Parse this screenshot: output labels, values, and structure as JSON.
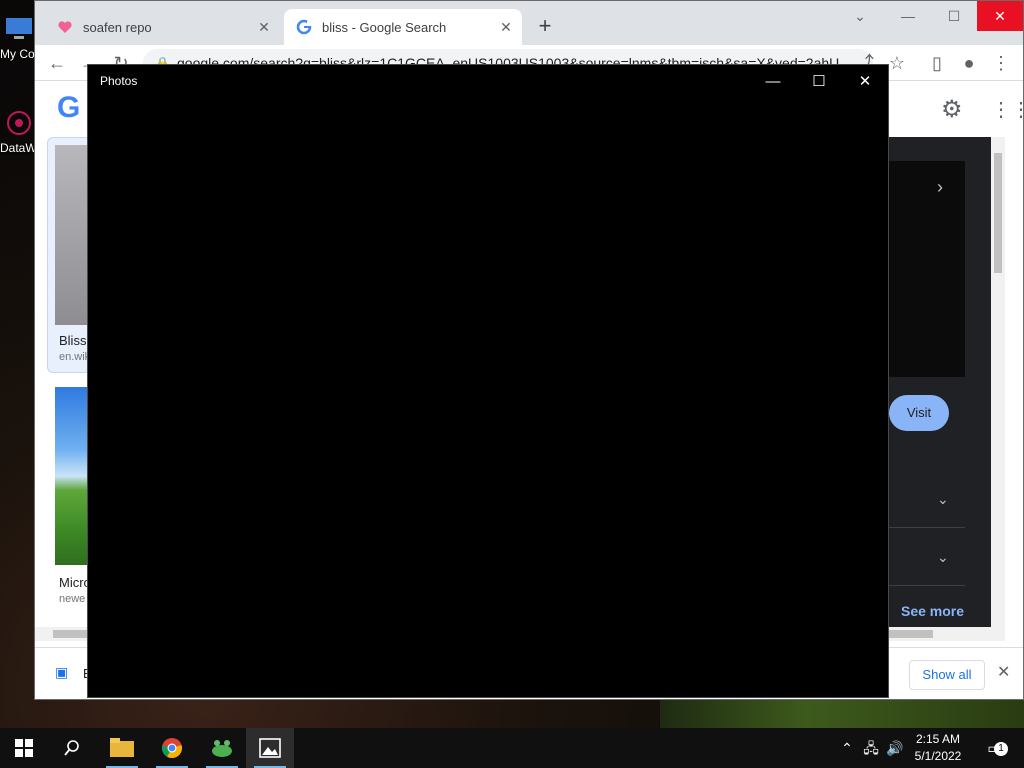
{
  "desktop": {
    "icons": [
      {
        "label": "My Co",
        "icon": "computer-icon"
      },
      {
        "label": "DataW",
        "icon": "datawrapper-icon"
      }
    ]
  },
  "browser": {
    "tabs": [
      {
        "title": "soafen repo",
        "icon": "heart-favicon",
        "active": false
      },
      {
        "title": "bliss - Google Search",
        "icon": "google-favicon",
        "active": true
      }
    ],
    "new_tab": "+",
    "window_controls": {
      "dropdown": "⌄",
      "minimize": "—",
      "maximize": "☐",
      "close": "✕"
    },
    "url": "google.com/search?q=bliss&rlz=1C1GCEA_enUS1003US1003&source=lnms&tbm=isch&sa=X&ved=2ahU",
    "page": {
      "logo": "G",
      "results": [
        {
          "title": "Bliss",
          "source": "en.wiki"
        },
        {
          "title": "Micro",
          "source": "newe"
        }
      ],
      "panel": {
        "visit_label": "Visit",
        "see_more": "See more"
      }
    },
    "download_bar": {
      "file_label": "B",
      "show_all": "Show all"
    }
  },
  "photos": {
    "title": "Photos",
    "controls": {
      "minimize": "—",
      "maximize": "☐",
      "close": "✕"
    }
  },
  "taskbar": {
    "apps": [
      {
        "name": "file-explorer",
        "running": true,
        "active": false
      },
      {
        "name": "chrome",
        "running": true,
        "active": false
      },
      {
        "name": "app-green",
        "running": true,
        "active": false
      },
      {
        "name": "photos",
        "running": true,
        "active": true
      }
    ],
    "clock_time": "2:15 AM",
    "clock_date": "5/1/2022",
    "notification_count": "1"
  },
  "colors": {
    "taskbar": "#101010",
    "chrome_tabstrip": "#dee1e6",
    "close_red": "#e81123",
    "visit_button": "#8ab4f8"
  }
}
